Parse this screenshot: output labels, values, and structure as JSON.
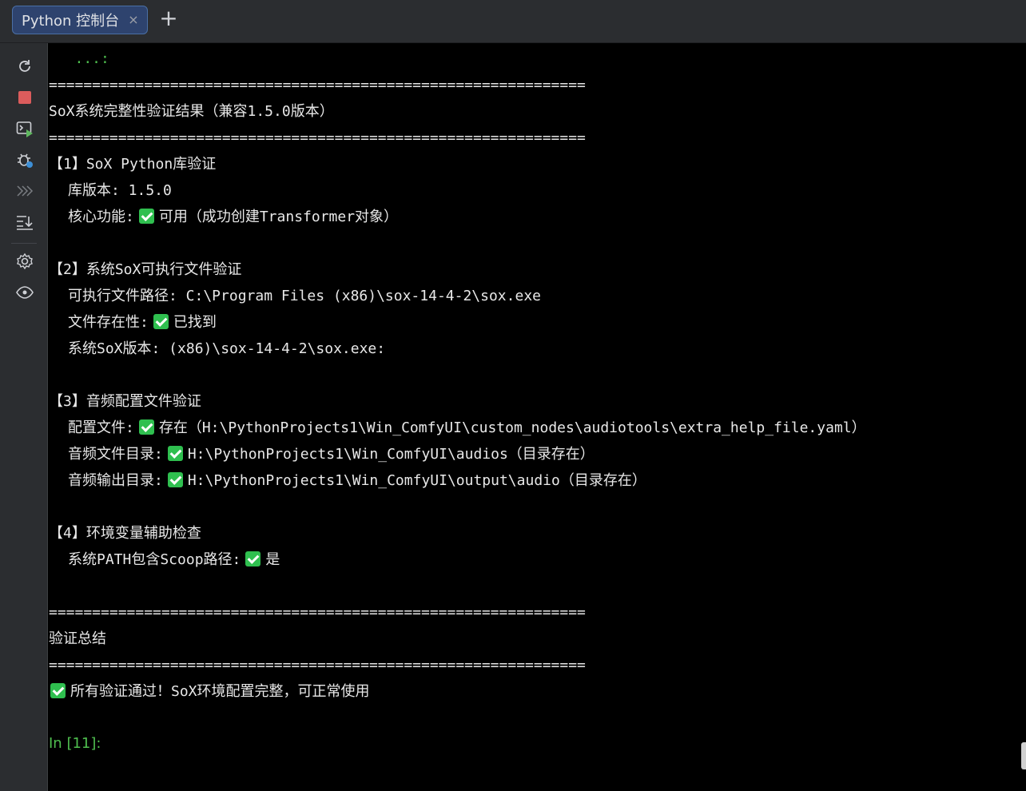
{
  "tab": {
    "title": "Python 控制台",
    "close": "×",
    "add": "+"
  },
  "toolbar": {
    "icons": [
      "rerun-icon",
      "stop-icon",
      "console-run-icon",
      "debug-icon",
      "more-icon",
      "scroll-to-end-icon",
      "settings-icon",
      "watch-icon"
    ]
  },
  "colors": {
    "prompt": "#4fbf4f",
    "check": "#2fbf4f",
    "tab_active": "#2e436e"
  },
  "console": {
    "continuation": "   ...:",
    "rule": "==============================================================",
    "title": "SoX系统完整性验证结果（兼容1.5.0版本）",
    "s1": {
      "heading": "【1】SoX Python库验证",
      "version": "库版本: 1.5.0",
      "core_label": "核心功能:",
      "core_value": "可用（成功创建Transformer对象）"
    },
    "s2": {
      "heading": "【2】系统SoX可执行文件验证",
      "path": "可执行文件路径: C:\\Program Files (x86)\\sox-14-4-2\\sox.exe",
      "exists_label": "文件存在性:",
      "exists_value": "已找到",
      "version": "系统SoX版本: (x86)\\sox-14-4-2\\sox.exe:"
    },
    "s3": {
      "heading": "【3】音频配置文件验证",
      "config_label": "配置文件:",
      "config_value": "存在（H:\\PythonProjects1\\Win_ComfyUI\\custom_nodes\\audiotools\\extra_help_file.yaml）",
      "input_label": "音频文件目录:",
      "input_value": "H:\\PythonProjects1\\Win_ComfyUI\\audios（目录存在）",
      "output_label": "音频输出目录:",
      "output_value": "H:\\PythonProjects1\\Win_ComfyUI\\output\\audio（目录存在）"
    },
    "s4": {
      "heading": "【4】环境变量辅助检查",
      "path_label": "系统PATH包含Scoop路径:",
      "path_value": "是"
    },
    "summary_title": "验证总结",
    "summary_value": "所有验证通过！SoX环境配置完整，可正常使用",
    "prompt": "In [11]:"
  }
}
